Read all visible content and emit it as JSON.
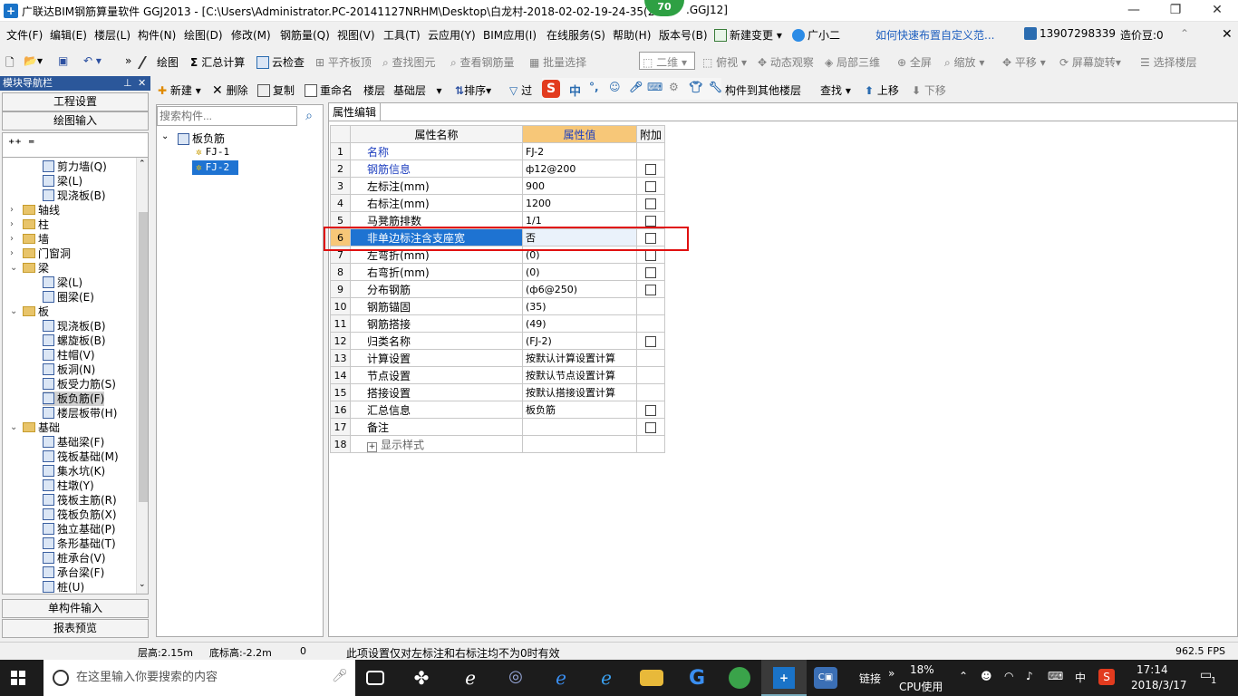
{
  "window": {
    "title": "广联达BIM钢筋算量软件 GGJ2013 - [C:\\Users\\Administrator.PC-20141127NRHM\\Desktop\\白龙村-2018-02-02-19-24-35(20",
    "title_tail": ".GGJ12]",
    "badge": "70"
  },
  "menu": {
    "items": [
      "文件(F)",
      "编辑(E)",
      "楼层(L)",
      "构件(N)",
      "绘图(D)",
      "修改(M)",
      "钢筋量(Q)",
      "视图(V)",
      "工具(T)",
      "云应用(Y)",
      "BIM应用(I)",
      "在线服务(S)",
      "帮助(H)",
      "版本号(B)"
    ],
    "new_change": "新建变更",
    "assistant": "广小二",
    "help_link": "如何快速布置自定义范...",
    "phone": "13907298339",
    "cost_beans": "造价豆:0"
  },
  "toolbar1": {
    "draw": "绘图",
    "sum_calc": "汇总计算",
    "cloud_check": "云检查",
    "level_top": "平齐板顶",
    "find_elem": "查找图元",
    "view_rebar": "查看钢筋量",
    "batch_select": "批量选择",
    "view_mode": "二维",
    "top_view": "俯视",
    "dynamic_view": "动态观察",
    "local_3d": "局部三维",
    "fullscreen": "全屏",
    "zoom": "缩放",
    "pan": "平移",
    "screen_rotate": "屏幕旋转",
    "select_floor": "选择楼层"
  },
  "toolbar2": {
    "new": "新建",
    "delete": "删除",
    "copy": "复制",
    "rename": "重命名",
    "floor_label": "楼层",
    "floor_value": "基础层",
    "sort": "排序",
    "filter": "过",
    "copy_to_floor": "构件到其他楼层",
    "find": "查找",
    "move_up": "上移",
    "move_down": "下移"
  },
  "left_panel": {
    "header": "模块导航栏",
    "pin": "ꟸ",
    "btn_project": "工程设置",
    "btn_draw": "绘图输入",
    "btn_single": "单构件输入",
    "btn_report": "报表预览",
    "tree": [
      {
        "label": "剪力墙(Q)",
        "level": 2
      },
      {
        "label": "梁(L)",
        "level": 2
      },
      {
        "label": "现浇板(B)",
        "level": 2
      },
      {
        "label": "轴线",
        "level": 0,
        "folder": true,
        "exp": "›"
      },
      {
        "label": "柱",
        "level": 0,
        "folder": true,
        "exp": "›"
      },
      {
        "label": "墙",
        "level": 0,
        "folder": true,
        "exp": "›"
      },
      {
        "label": "门窗洞",
        "level": 0,
        "folder": true,
        "exp": "›"
      },
      {
        "label": "梁",
        "level": 0,
        "folder": true,
        "exp": "⌄"
      },
      {
        "label": "梁(L)",
        "level": 2
      },
      {
        "label": "圈梁(E)",
        "level": 2
      },
      {
        "label": "板",
        "level": 0,
        "folder": true,
        "exp": "⌄"
      },
      {
        "label": "现浇板(B)",
        "level": 2
      },
      {
        "label": "螺旋板(B)",
        "level": 2
      },
      {
        "label": "柱帽(V)",
        "level": 2
      },
      {
        "label": "板洞(N)",
        "level": 2
      },
      {
        "label": "板受力筋(S)",
        "level": 2
      },
      {
        "label": "板负筋(F)",
        "level": 2,
        "selected": true
      },
      {
        "label": "楼层板带(H)",
        "level": 2
      },
      {
        "label": "基础",
        "level": 0,
        "folder": true,
        "exp": "⌄"
      },
      {
        "label": "基础梁(F)",
        "level": 2
      },
      {
        "label": "筏板基础(M)",
        "level": 2
      },
      {
        "label": "集水坑(K)",
        "level": 2
      },
      {
        "label": "柱墩(Y)",
        "level": 2
      },
      {
        "label": "筏板主筋(R)",
        "level": 2
      },
      {
        "label": "筏板负筋(X)",
        "level": 2
      },
      {
        "label": "独立基础(P)",
        "level": 2
      },
      {
        "label": "条形基础(T)",
        "level": 2
      },
      {
        "label": "桩承台(V)",
        "level": 2
      },
      {
        "label": "承台梁(F)",
        "level": 2
      },
      {
        "label": "桩(U)",
        "level": 2
      }
    ]
  },
  "mid_panel": {
    "search_placeholder": "搜索构件...",
    "root": "板负筋",
    "items": [
      "FJ-1",
      "FJ-2"
    ]
  },
  "prop_panel": {
    "tab": "属性编辑",
    "col_name": "属性名称",
    "col_value": "属性值",
    "col_add": "附加",
    "rows": [
      {
        "n": "1",
        "name": "名称",
        "value": "FJ-2",
        "blue": true,
        "chk": false
      },
      {
        "n": "2",
        "name": "钢筋信息",
        "value": "ф12@200",
        "blue": true,
        "chk": true
      },
      {
        "n": "3",
        "name": "左标注(mm)",
        "value": "900",
        "chk": true
      },
      {
        "n": "4",
        "name": "右标注(mm)",
        "value": "1200",
        "chk": true
      },
      {
        "n": "5",
        "name": "马凳筋排数",
        "value": "1/1",
        "chk": true
      },
      {
        "n": "6",
        "name": "非单边标注含支座宽",
        "value": "否",
        "chk": true,
        "sel": true
      },
      {
        "n": "7",
        "name": "左弯折(mm)",
        "value": "(0)",
        "chk": true
      },
      {
        "n": "8",
        "name": "右弯折(mm)",
        "value": "(0)",
        "chk": true
      },
      {
        "n": "9",
        "name": "分布钢筋",
        "value": "(ф6@250)",
        "chk": true
      },
      {
        "n": "10",
        "name": "钢筋锚固",
        "value": "(35)",
        "chk": false
      },
      {
        "n": "11",
        "name": "钢筋搭接",
        "value": "(49)",
        "chk": false
      },
      {
        "n": "12",
        "name": "归类名称",
        "value": "(FJ-2)",
        "chk": true
      },
      {
        "n": "13",
        "name": "计算设置",
        "value": "按默认计算设置计算",
        "chk": false
      },
      {
        "n": "14",
        "name": "节点设置",
        "value": "按默认节点设置计算",
        "chk": false
      },
      {
        "n": "15",
        "name": "搭接设置",
        "value": "按默认搭接设置计算",
        "chk": false
      },
      {
        "n": "16",
        "name": "汇总信息",
        "value": "板负筋",
        "chk": true
      },
      {
        "n": "17",
        "name": "备注",
        "value": "",
        "chk": true
      },
      {
        "n": "18",
        "name": "显示样式",
        "value": "",
        "chk": false,
        "expander": true
      }
    ]
  },
  "status": {
    "floor_height": "层高:2.15m",
    "bottom_elev": "底标高:-2.2m",
    "zero": "0",
    "hint": "此项设置仅对左标注和右标注均不为0时有效",
    "fps": "962.5 FPS"
  },
  "taskbar": {
    "search_placeholder": "在这里输入你要搜索的内容",
    "link": "链接",
    "cpu_pct": "18%",
    "cpu_label": "CPU使用",
    "ime": "中",
    "time": "17:14",
    "date": "2018/3/17",
    "notif": "1"
  }
}
